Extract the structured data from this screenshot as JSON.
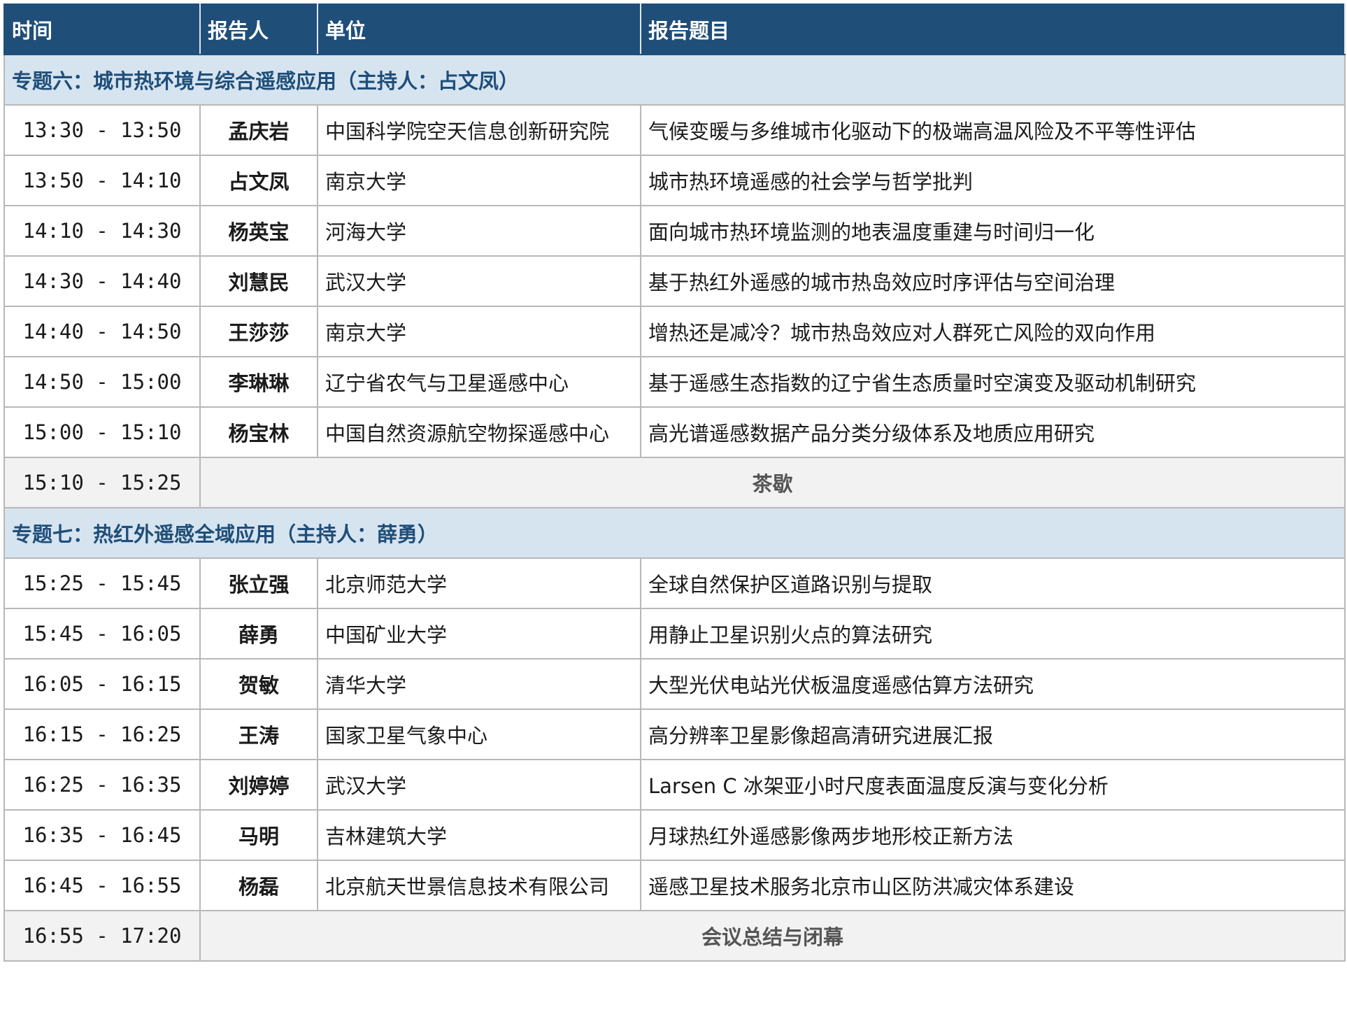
{
  "headers": {
    "time": "时间",
    "speaker": "报告人",
    "org": "单位",
    "topic": "报告题目"
  },
  "sections": [
    {
      "title": "专题六：城市热环境与综合遥感应用（主持人：占文凤）",
      "rows": [
        {
          "time": "13:30 - 13:50",
          "speaker": "孟庆岩",
          "org": "中国科学院空天信息创新研究院",
          "topic": "气候变暖与多维城市化驱动下的极端高温风险及不平等性评估"
        },
        {
          "time": "13:50 - 14:10",
          "speaker": "占文凤",
          "org": "南京大学",
          "topic": "城市热环境遥感的社会学与哲学批判"
        },
        {
          "time": "14:10 - 14:30",
          "speaker": "杨英宝",
          "org": "河海大学",
          "topic": "面向城市热环境监测的地表温度重建与时间归一化"
        },
        {
          "time": "14:30 - 14:40",
          "speaker": "刘慧民",
          "org": "武汉大学",
          "topic": "基于热红外遥感的城市热岛效应时序评估与空间治理"
        },
        {
          "time": "14:40 - 14:50",
          "speaker": "王莎莎",
          "org": "南京大学",
          "topic": "增热还是减冷？城市热岛效应对人群死亡风险的双向作用"
        },
        {
          "time": "14:50 - 15:00",
          "speaker": "李琳琳",
          "org": "辽宁省农气与卫星遥感中心",
          "topic": "基于遥感生态指数的辽宁省生态质量时空演变及驱动机制研究"
        },
        {
          "time": "15:00 - 15:10",
          "speaker": "杨宝林",
          "org": "中国自然资源航空物探遥感中心",
          "topic": "高光谱遥感数据产品分类分级体系及地质应用研究"
        }
      ],
      "break": {
        "time": "15:10 - 15:25",
        "label": "茶歇"
      }
    },
    {
      "title": "专题七：热红外遥感全域应用（主持人：薛勇）",
      "rows": [
        {
          "time": "15:25 - 15:45",
          "speaker": "张立强",
          "org": "北京师范大学",
          "topic": "全球自然保护区道路识别与提取"
        },
        {
          "time": "15:45 - 16:05",
          "speaker": "薛勇",
          "org": "中国矿业大学",
          "topic": "用静止卫星识别火点的算法研究"
        },
        {
          "time": "16:05 - 16:15",
          "speaker": "贺敏",
          "org": "清华大学",
          "topic": "大型光伏电站光伏板温度遥感估算方法研究"
        },
        {
          "time": "16:15 - 16:25",
          "speaker": "王涛",
          "org": "国家卫星气象中心",
          "topic": "高分辨率卫星影像超高清研究进展汇报"
        },
        {
          "time": "16:25 - 16:35",
          "speaker": "刘婷婷",
          "org": "武汉大学",
          "topic": "Larsen C 冰架亚小时尺度表面温度反演与变化分析"
        },
        {
          "time": "16:35 - 16:45",
          "speaker": "马明",
          "org": "吉林建筑大学",
          "topic": "月球热红外遥感影像两步地形校正新方法"
        },
        {
          "time": "16:45 - 16:55",
          "speaker": "杨磊",
          "org": "北京航天世景信息技术有限公司",
          "topic": "遥感卫星技术服务北京市山区防洪减灾体系建设"
        }
      ],
      "break": {
        "time": "16:55 - 17:20",
        "label": "会议总结与闭幕"
      }
    }
  ]
}
